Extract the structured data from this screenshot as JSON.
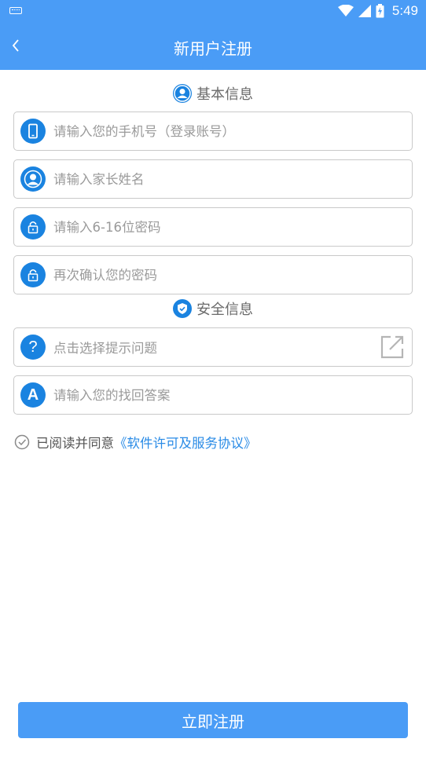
{
  "status_bar": {
    "time": "5:49"
  },
  "app_bar": {
    "title": "新用户注册"
  },
  "sections": {
    "basic": "基本信息",
    "security": "安全信息"
  },
  "fields": {
    "phone_placeholder": "请输入您的手机号（登录账号）",
    "parent_name_placeholder": "请输入家长姓名",
    "password_placeholder": "请输入6-16位密码",
    "confirm_password_placeholder": "再次确认您的密码",
    "question_placeholder": "点击选择提示问题",
    "answer_placeholder": "请输入您的找回答案"
  },
  "agreement": {
    "prefix": "已阅读并同意",
    "link": "《软件许可及服务协议》"
  },
  "submit_label": "立即注册",
  "colors": {
    "primary": "#4a9cf6",
    "icon_blue": "#1a83e0",
    "link": "#2a8be6"
  }
}
